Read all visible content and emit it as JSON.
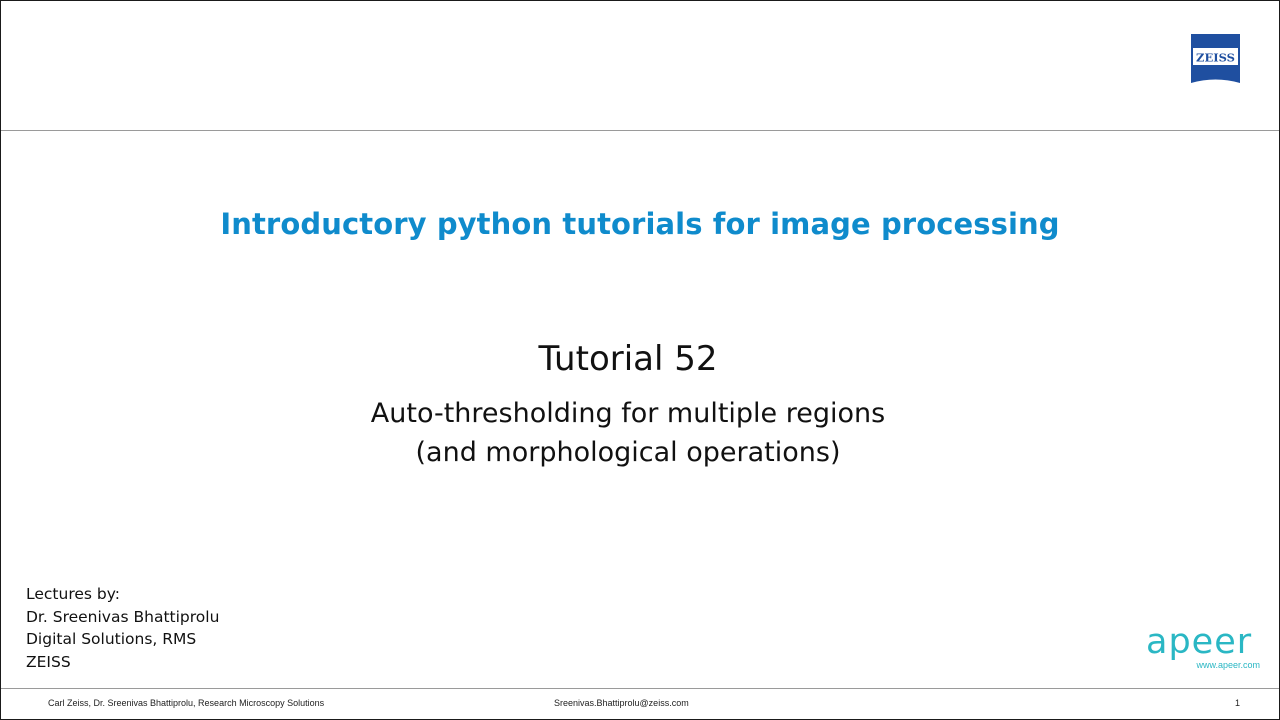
{
  "logo": {
    "text": "ZEISS",
    "color": "#1f4fa0",
    "icon": "zeiss-logo-icon"
  },
  "headline": "Introductory python tutorials for image processing",
  "tutorial": {
    "number": "Tutorial 52",
    "subtitle_lines": [
      "Auto-thresholding for multiple regions",
      "(and morphological operations)"
    ]
  },
  "credits": {
    "lines": [
      "Lectures by:",
      "Dr. Sreenivas Bhattiprolu",
      "Digital Solutions, RMS",
      "ZEISS"
    ]
  },
  "apeer": {
    "word": "apeer",
    "url": "www.apeer.com",
    "color": "#2ab7c4"
  },
  "footer": {
    "left": "Carl Zeiss, Dr. Sreenivas Bhattiprolu, Research Microscopy Solutions",
    "center": "Sreenivas.Bhattiprolu@zeiss.com",
    "page": "1"
  },
  "colors": {
    "headline": "#0f8bcc",
    "rule": "#9a9a9a"
  }
}
